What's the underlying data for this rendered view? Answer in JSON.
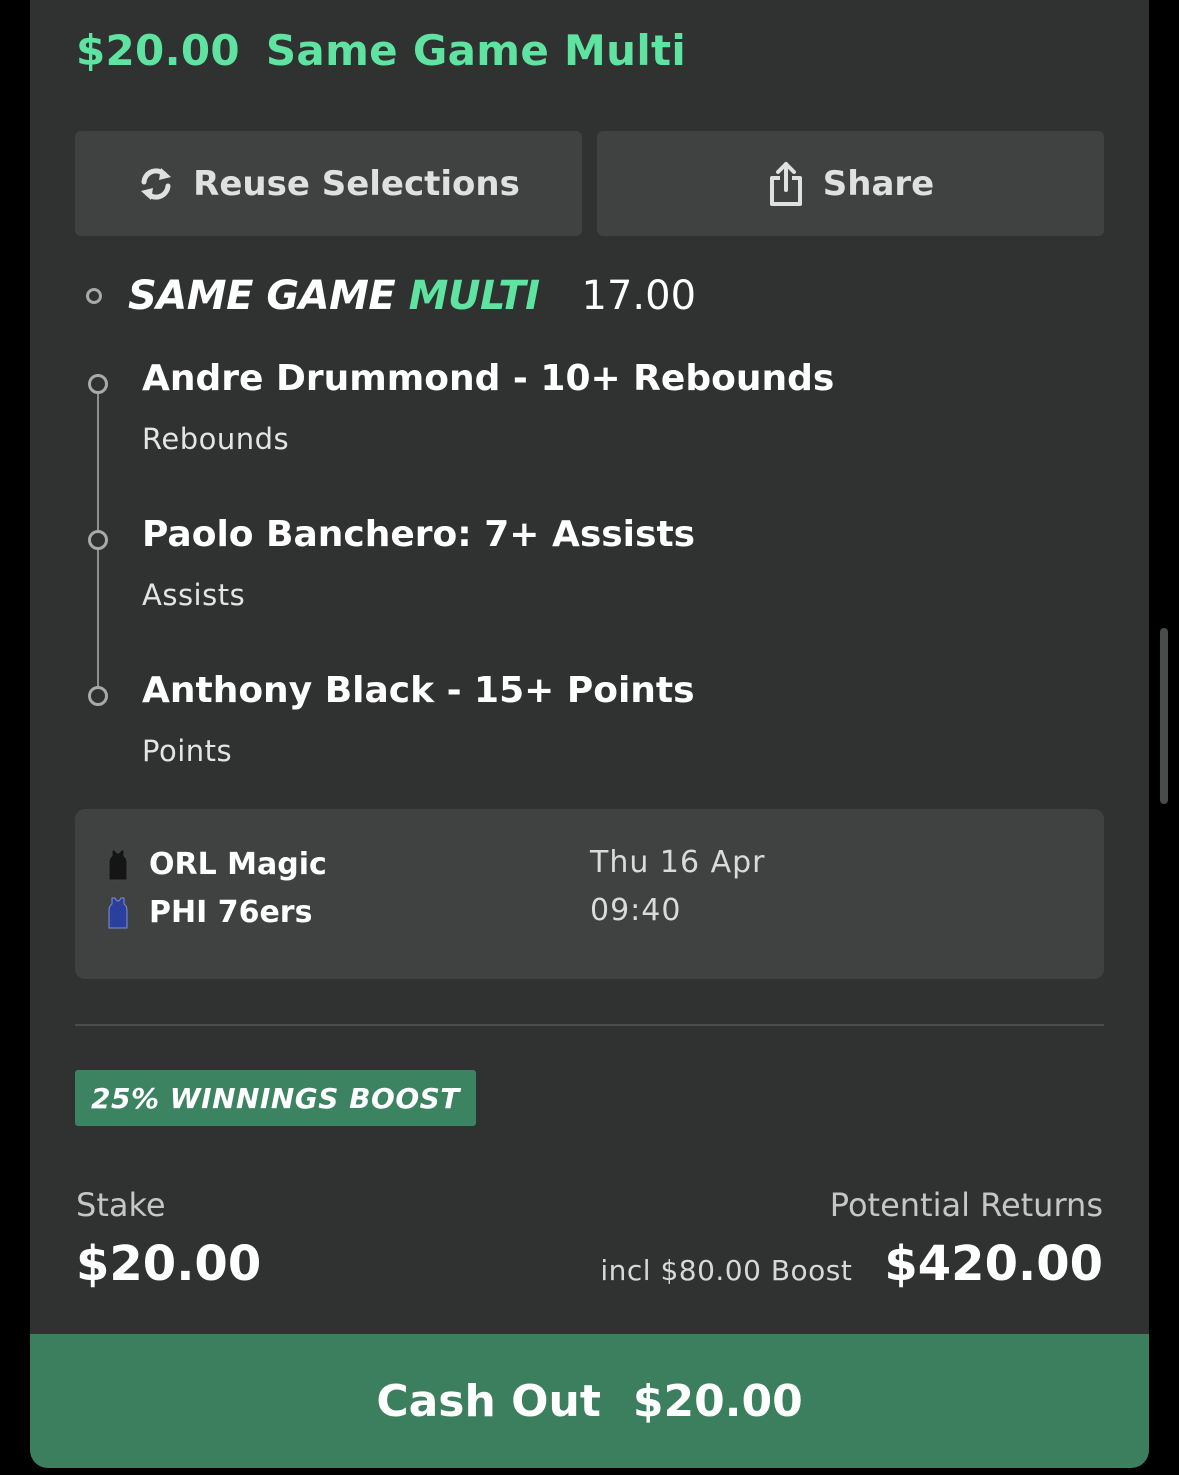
{
  "header": {
    "amount": "$20.00",
    "bet_type": "Same Game Multi"
  },
  "actions": {
    "reuse_label": "Reuse Selections",
    "reuse_icon": "refresh-icon",
    "share_label": "Share",
    "share_icon": "share-icon"
  },
  "sgm": {
    "title_part1": "SAME GAME ",
    "title_part2": "MULTI",
    "odds": "17.00"
  },
  "legs": [
    {
      "title": "Andre Drummond - 10+ Rebounds",
      "market": "Rebounds"
    },
    {
      "title": "Paolo Banchero: 7+ Assists",
      "market": "Assists"
    },
    {
      "title": "Anthony Black - 15+ Points",
      "market": "Points"
    }
  ],
  "game": {
    "home_team": "ORL Magic",
    "home_icon": "jersey-black-icon",
    "away_team": "PHI 76ers",
    "away_icon": "jersey-blue-icon",
    "date": "Thu 16 Apr",
    "time": "09:40"
  },
  "boost": {
    "badge": "25% WINNINGS BOOST"
  },
  "stake": {
    "label": "Stake",
    "value": "$20.00"
  },
  "returns": {
    "label": "Potential Returns",
    "boost_note": "incl $80.00 Boost",
    "value": "$420.00"
  },
  "cashout": {
    "label": "Cash Out",
    "amount": "$20.00"
  },
  "colors": {
    "accent": "#5fe3a1",
    "card_bg": "#2f3231",
    "button_bg": "#3f4241",
    "cashout_bg": "#3b7f5f",
    "boost_bg": "#3c8362"
  }
}
